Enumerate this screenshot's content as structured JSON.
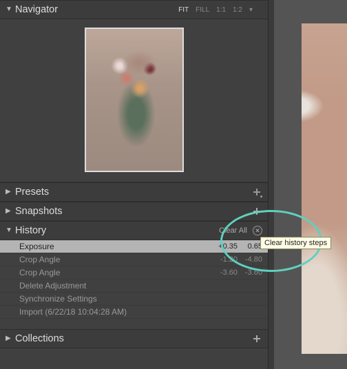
{
  "navigator": {
    "title": "Navigator",
    "zoom": {
      "fit": "FIT",
      "fill": "FILL",
      "one": "1:1",
      "two": "1:2"
    }
  },
  "presets": {
    "title": "Presets"
  },
  "snapshots": {
    "title": "Snapshots"
  },
  "history": {
    "title": "History",
    "clear_label": "Clear All",
    "rows": [
      {
        "name": "Exposure",
        "v1": "+0.35",
        "v2": "0.65"
      },
      {
        "name": "Crop Angle",
        "v1": "-1.20",
        "v2": "-4.80"
      },
      {
        "name": "Crop Angle",
        "v1": "-3.60",
        "v2": "-3.60"
      },
      {
        "name": "Delete Adjustment",
        "v1": "",
        "v2": ""
      },
      {
        "name": "Synchronize Settings",
        "v1": "",
        "v2": ""
      },
      {
        "name": "Import (6/22/18 10:04:28 AM)",
        "v1": "",
        "v2": ""
      }
    ]
  },
  "collections": {
    "title": "Collections"
  },
  "tooltip": "Clear history steps"
}
